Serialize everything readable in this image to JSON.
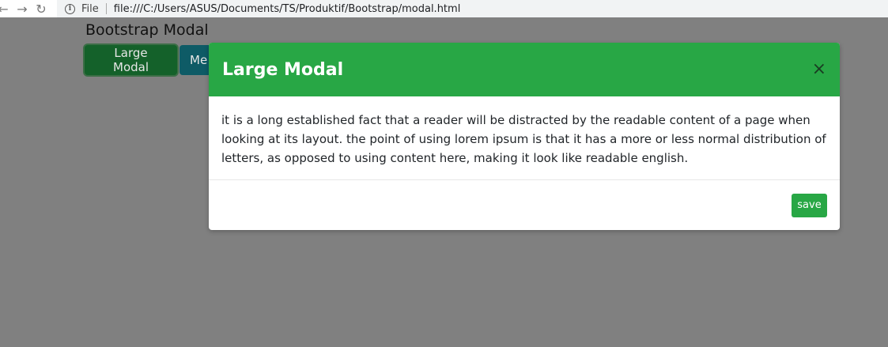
{
  "browser": {
    "back_icon": "arrow-left-icon",
    "forward_icon": "arrow-right-icon",
    "reload_icon": "reload-icon",
    "info_icon": "info-icon",
    "scheme_label": "File",
    "url": "file:///C:/Users/ASUS/Documents/TS/Produktif/Bootstrap/modal.html"
  },
  "page": {
    "title": "Bootstrap Modal",
    "buttons": {
      "large_label": "Large Modal",
      "medium_label": "Me"
    }
  },
  "modal": {
    "title": "Large Modal",
    "close_label": "×",
    "body_text": "it is a long established fact that a reader will be distracted by the readable content of a page when looking at its layout. the point of using lorem ipsum is that it has a more or less normal distribution of letters, as opposed to using content here, making it look like readable english.",
    "save_label": "save"
  },
  "colors": {
    "backdrop": "#808080",
    "modal_header": "#28a745",
    "large_button": "#14612a",
    "medium_button": "#0e5b66",
    "save_button": "#28a745"
  }
}
